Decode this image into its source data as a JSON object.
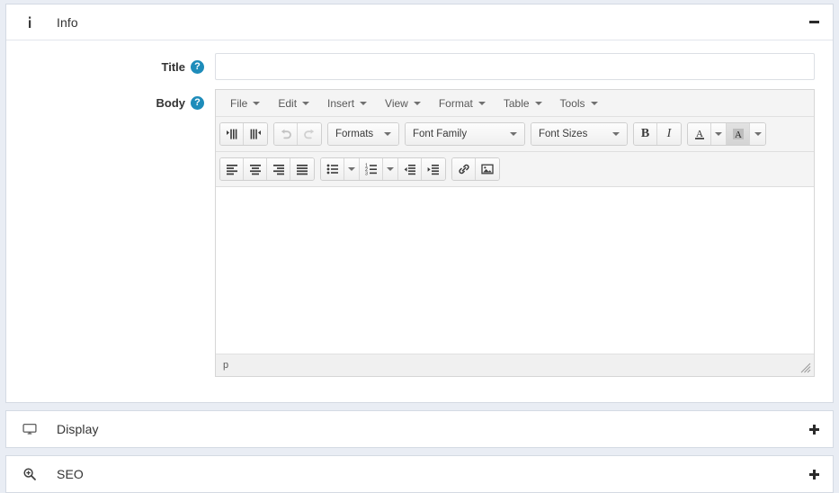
{
  "theme": {
    "page_background": "#e9edf4",
    "panel_background": "#ffffff",
    "panel_border": "#d4dae3",
    "help_icon_color": "#1e8cba",
    "toolbar_background": "#f4f4f4",
    "text_color": "#333333"
  },
  "panels": [
    {
      "id": "info",
      "title": "Info",
      "icon": "info-icon",
      "state": "expanded",
      "toggle_label": "−",
      "toggle_name": "collapse-minus-icon"
    },
    {
      "id": "display",
      "title": "Display",
      "icon": "monitor-icon",
      "state": "collapsed",
      "toggle_label": "+",
      "toggle_name": "expand-plus-icon"
    },
    {
      "id": "seo",
      "title": "SEO",
      "icon": "magnifier-plus-icon",
      "state": "collapsed",
      "toggle_label": "+",
      "toggle_name": "expand-plus-icon"
    }
  ],
  "form": {
    "title_field": {
      "label": "Title",
      "help": "?",
      "value": "",
      "placeholder": ""
    },
    "body_field": {
      "label": "Body",
      "help": "?"
    }
  },
  "editor": {
    "menubar": [
      {
        "label": "File",
        "name": "menu-file"
      },
      {
        "label": "Edit",
        "name": "menu-edit"
      },
      {
        "label": "Insert",
        "name": "menu-insert"
      },
      {
        "label": "View",
        "name": "menu-view"
      },
      {
        "label": "Format",
        "name": "menu-format"
      },
      {
        "label": "Table",
        "name": "menu-table"
      },
      {
        "label": "Tools",
        "name": "menu-tools"
      }
    ],
    "toolbar_row1": {
      "direction": [
        {
          "name": "ltr-icon",
          "title": "Left to right"
        },
        {
          "name": "rtl-icon",
          "title": "Right to left"
        }
      ],
      "history": [
        {
          "name": "undo-icon",
          "title": "Undo",
          "disabled": true
        },
        {
          "name": "redo-icon",
          "title": "Redo",
          "disabled": true
        }
      ],
      "formats_label": "Formats",
      "font_family_label": "Font Family",
      "font_sizes_label": "Font Sizes",
      "bold_label": "B",
      "italic_label": "I",
      "text_color_label": "A",
      "background_color_label": "A"
    },
    "toolbar_row2": {
      "align": [
        {
          "name": "align-left-icon"
        },
        {
          "name": "align-center-icon"
        },
        {
          "name": "align-right-icon"
        },
        {
          "name": "align-justify-icon"
        }
      ],
      "lists": [
        {
          "name": "bullet-list-icon"
        },
        {
          "name": "numbered-list-icon"
        }
      ],
      "indent": [
        {
          "name": "outdent-icon"
        },
        {
          "name": "indent-icon"
        }
      ],
      "insert": [
        {
          "name": "link-icon"
        },
        {
          "name": "image-icon"
        }
      ]
    },
    "content": "",
    "statusbar": {
      "element_path": "p",
      "resize_handle": "resize-grip-icon"
    }
  }
}
